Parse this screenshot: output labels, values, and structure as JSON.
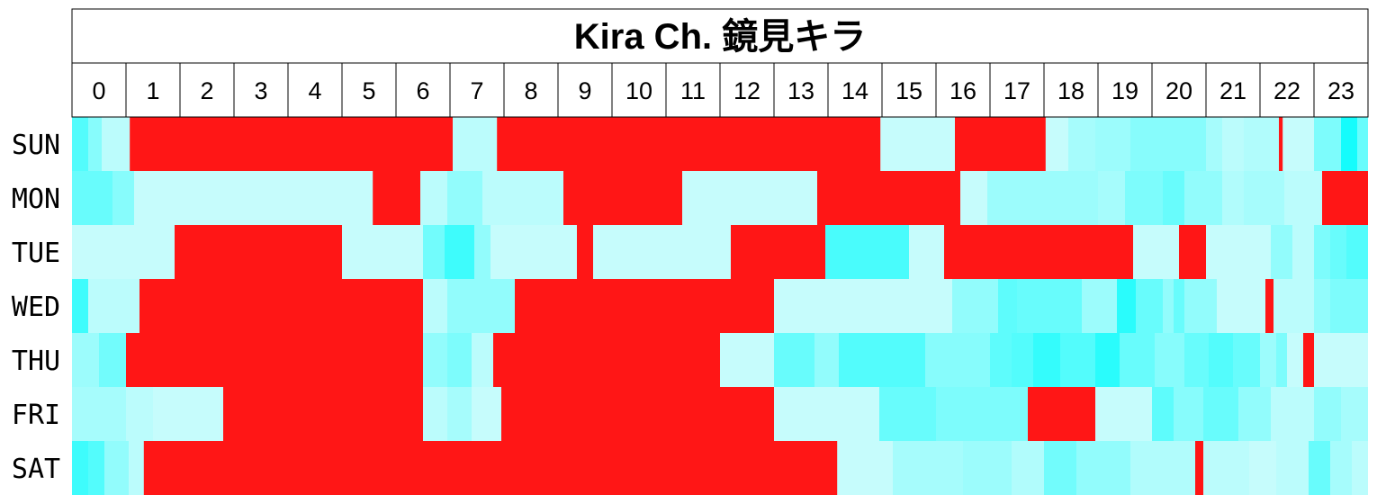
{
  "chart_data": {
    "type": "heatmap",
    "title": "Kira Ch. 鏡見キラ",
    "hours": [
      "0",
      "1",
      "2",
      "3",
      "4",
      "5",
      "6",
      "7",
      "8",
      "9",
      "10",
      "11",
      "12",
      "13",
      "14",
      "15",
      "16",
      "17",
      "18",
      "19",
      "20",
      "21",
      "22",
      "23"
    ],
    "days": [
      "SUN",
      "MON",
      "TUE",
      "WED",
      "THU",
      "FRI",
      "SAT"
    ],
    "value_meaning": "0 = no activity (light cyan), 1 = highest activity (bright cyan), live = red",
    "colors": {
      "live": "#FF1616",
      "low": "#D0FCFC",
      "high": "#00FCFC",
      "grid": "#000000"
    },
    "rows": [
      {
        "day": "SUN",
        "live": [
          [
            1.07,
            7.05
          ],
          [
            7.87,
            14.97
          ],
          [
            16.35,
            18.03
          ],
          [
            22.35,
            22.42
          ]
        ],
        "segments": [
          [
            0,
            0.3,
            0.6
          ],
          [
            0.3,
            0.55,
            0.35
          ],
          [
            0.55,
            1.07,
            0.1
          ],
          [
            7.05,
            7.87,
            0.1
          ],
          [
            14.97,
            16.35,
            0.05
          ],
          [
            18.03,
            18.45,
            0.05
          ],
          [
            18.45,
            18.95,
            0.2
          ],
          [
            18.95,
            19.6,
            0.25
          ],
          [
            19.6,
            20.3,
            0.35
          ],
          [
            20.3,
            21.0,
            0.35
          ],
          [
            21.0,
            21.3,
            0.2
          ],
          [
            21.3,
            21.7,
            0.1
          ],
          [
            21.7,
            22.35,
            0.15
          ],
          [
            22.42,
            23.0,
            0.05
          ],
          [
            23.0,
            23.5,
            0.4
          ],
          [
            23.5,
            23.8,
            0.9
          ],
          [
            23.8,
            24.0,
            0.5
          ]
        ]
      },
      {
        "day": "MON",
        "live": [
          [
            5.57,
            6.45
          ],
          [
            9.1,
            11.3
          ],
          [
            13.8,
            16.45
          ],
          [
            23.15,
            24.0
          ]
        ],
        "segments": [
          [
            0,
            0.75,
            0.5
          ],
          [
            0.75,
            1.15,
            0.35
          ],
          [
            1.15,
            5.57,
            0.05
          ],
          [
            6.45,
            6.95,
            0.1
          ],
          [
            6.95,
            7.6,
            0.3
          ],
          [
            7.6,
            9.1,
            0.1
          ],
          [
            11.3,
            13.8,
            0.05
          ],
          [
            16.45,
            16.95,
            0.05
          ],
          [
            16.95,
            18.0,
            0.25
          ],
          [
            18.0,
            19.0,
            0.25
          ],
          [
            19.0,
            19.5,
            0.2
          ],
          [
            19.5,
            20.2,
            0.4
          ],
          [
            20.2,
            20.6,
            0.5
          ],
          [
            20.6,
            21.3,
            0.3
          ],
          [
            21.3,
            21.7,
            0.15
          ],
          [
            21.7,
            22.45,
            0.2
          ],
          [
            22.45,
            23.15,
            0.1
          ]
        ]
      },
      {
        "day": "TUE",
        "live": [
          [
            1.9,
            5.0
          ],
          [
            9.35,
            9.65
          ],
          [
            12.2,
            13.95
          ],
          [
            16.15,
            19.5
          ],
          [
            19.5,
            19.65
          ],
          [
            20.5,
            21.0
          ]
        ],
        "segments": [
          [
            0,
            1.9,
            0.05
          ],
          [
            5.0,
            6.5,
            0.05
          ],
          [
            6.5,
            6.9,
            0.45
          ],
          [
            6.9,
            7.45,
            0.7
          ],
          [
            7.45,
            7.75,
            0.3
          ],
          [
            7.75,
            9.35,
            0.05
          ],
          [
            9.65,
            12.2,
            0.05
          ],
          [
            13.95,
            15.5,
            0.65
          ],
          [
            15.5,
            16.15,
            0.05
          ],
          [
            19.65,
            20.5,
            0.05
          ],
          [
            21.0,
            22.2,
            0.05
          ],
          [
            22.2,
            22.6,
            0.3
          ],
          [
            22.6,
            23.0,
            0.1
          ],
          [
            23.0,
            23.3,
            0.4
          ],
          [
            23.3,
            23.6,
            0.5
          ],
          [
            23.6,
            24.0,
            0.6
          ]
        ]
      },
      {
        "day": "WED",
        "live": [
          [
            1.25,
            6.5
          ],
          [
            8.2,
            13.0
          ],
          [
            22.1,
            22.25
          ]
        ],
        "segments": [
          [
            0,
            0.3,
            0.7
          ],
          [
            0.3,
            1.25,
            0.1
          ],
          [
            6.5,
            6.95,
            0.1
          ],
          [
            6.95,
            8.2,
            0.3
          ],
          [
            13.0,
            16.3,
            0.05
          ],
          [
            16.3,
            17.15,
            0.3
          ],
          [
            17.15,
            17.5,
            0.55
          ],
          [
            17.5,
            18.7,
            0.5
          ],
          [
            18.7,
            19.35,
            0.25
          ],
          [
            19.35,
            19.7,
            0.8
          ],
          [
            19.7,
            20.2,
            0.5
          ],
          [
            20.2,
            20.4,
            0.3
          ],
          [
            20.4,
            20.6,
            0.5
          ],
          [
            20.6,
            21.2,
            0.3
          ],
          [
            21.2,
            22.1,
            0.05
          ],
          [
            22.25,
            23.0,
            0.1
          ],
          [
            23.0,
            23.3,
            0.3
          ],
          [
            23.3,
            24.0,
            0.4
          ]
        ]
      },
      {
        "day": "THU",
        "live": [
          [
            1.0,
            6.5
          ],
          [
            7.8,
            12.0
          ],
          [
            22.8,
            23.0
          ]
        ],
        "segments": [
          [
            0,
            0.5,
            0.25
          ],
          [
            0.5,
            1.0,
            0.45
          ],
          [
            6.5,
            6.95,
            0.3
          ],
          [
            6.95,
            7.4,
            0.4
          ],
          [
            7.4,
            7.8,
            0.1
          ],
          [
            12.0,
            13.0,
            0.05
          ],
          [
            13.0,
            13.75,
            0.5
          ],
          [
            13.75,
            14.2,
            0.3
          ],
          [
            14.2,
            15.8,
            0.6
          ],
          [
            15.8,
            17.0,
            0.35
          ],
          [
            17.0,
            17.4,
            0.55
          ],
          [
            17.4,
            17.8,
            0.6
          ],
          [
            17.8,
            18.3,
            0.75
          ],
          [
            18.3,
            18.95,
            0.6
          ],
          [
            18.95,
            19.4,
            0.8
          ],
          [
            19.4,
            20.05,
            0.5
          ],
          [
            20.05,
            20.6,
            0.35
          ],
          [
            20.6,
            21.05,
            0.5
          ],
          [
            21.05,
            21.5,
            0.6
          ],
          [
            21.5,
            22.0,
            0.5
          ],
          [
            22.0,
            22.3,
            0.25
          ],
          [
            22.3,
            22.5,
            0.4
          ],
          [
            22.5,
            22.8,
            0.05
          ],
          [
            23.0,
            24.0,
            0.05
          ]
        ]
      },
      {
        "day": "FRI",
        "live": [
          [
            2.8,
            6.5
          ],
          [
            7.95,
            13.0
          ],
          [
            17.7,
            18.95
          ]
        ],
        "segments": [
          [
            0,
            1.0,
            0.2
          ],
          [
            1.0,
            1.5,
            0.1
          ],
          [
            1.5,
            2.8,
            0.05
          ],
          [
            6.5,
            6.95,
            0.1
          ],
          [
            6.95,
            7.4,
            0.2
          ],
          [
            7.4,
            7.95,
            0.05
          ],
          [
            13.0,
            14.95,
            0.05
          ],
          [
            14.95,
            16.0,
            0.5
          ],
          [
            16.0,
            17.7,
            0.4
          ],
          [
            18.95,
            20.0,
            0.05
          ],
          [
            20.0,
            20.4,
            0.55
          ],
          [
            20.4,
            20.95,
            0.35
          ],
          [
            20.95,
            21.6,
            0.5
          ],
          [
            21.6,
            22.2,
            0.3
          ],
          [
            22.2,
            23.0,
            0.1
          ],
          [
            23.0,
            23.5,
            0.3
          ],
          [
            23.5,
            24.0,
            0.2
          ]
        ]
      },
      {
        "day": "SAT",
        "live": [
          [
            1.33,
            14.17
          ],
          [
            20.8,
            20.95
          ]
        ],
        "segments": [
          [
            0,
            0.3,
            0.7
          ],
          [
            0.3,
            0.6,
            0.6
          ],
          [
            0.6,
            1.05,
            0.3
          ],
          [
            1.05,
            1.33,
            0.1
          ],
          [
            14.17,
            15.2,
            0.05
          ],
          [
            15.2,
            16.5,
            0.2
          ],
          [
            16.5,
            17.4,
            0.25
          ],
          [
            17.4,
            18.0,
            0.15
          ],
          [
            18.0,
            18.6,
            0.45
          ],
          [
            18.6,
            19.6,
            0.3
          ],
          [
            19.6,
            20.8,
            0.15
          ],
          [
            20.95,
            21.8,
            0.1
          ],
          [
            21.8,
            22.3,
            0.05
          ],
          [
            22.3,
            22.9,
            0.1
          ],
          [
            22.9,
            23.3,
            0.5
          ],
          [
            23.3,
            23.7,
            0.2
          ],
          [
            23.7,
            24.0,
            0.1
          ]
        ]
      }
    ]
  }
}
